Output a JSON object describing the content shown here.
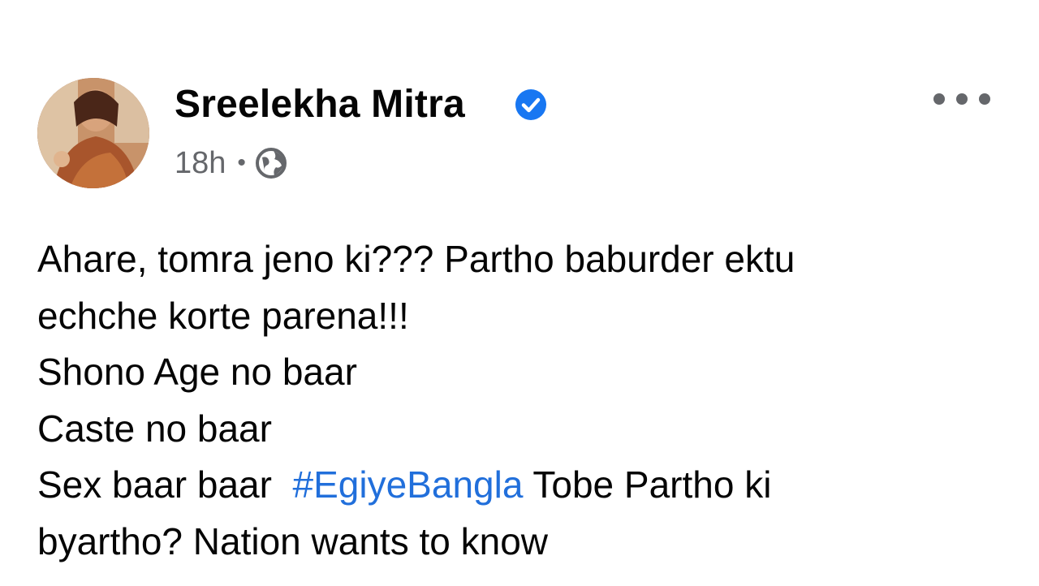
{
  "post": {
    "author": {
      "name": "Sreelekha Mitra",
      "verified": true,
      "verified_color": "#1877f2"
    },
    "meta": {
      "timestamp": "18h",
      "separator": "•",
      "audience_icon": "globe-icon"
    },
    "menu_icon": "more-options-icon",
    "body": {
      "line1": "Ahare, tomra jeno ki??? Partho baburder ektu",
      "line2": "echche korte parena!!!",
      "line3": "Shono Age no baar",
      "line4": "Caste no baar",
      "line5_before": "Sex baar baar",
      "hashtag": "#EgiyeBangla",
      "line5_after": "Tobe Partho ki",
      "line6": "byartho? Nation wants to know"
    },
    "colors": {
      "hashtag": "#216fdb",
      "meta_text": "#65676b"
    }
  }
}
